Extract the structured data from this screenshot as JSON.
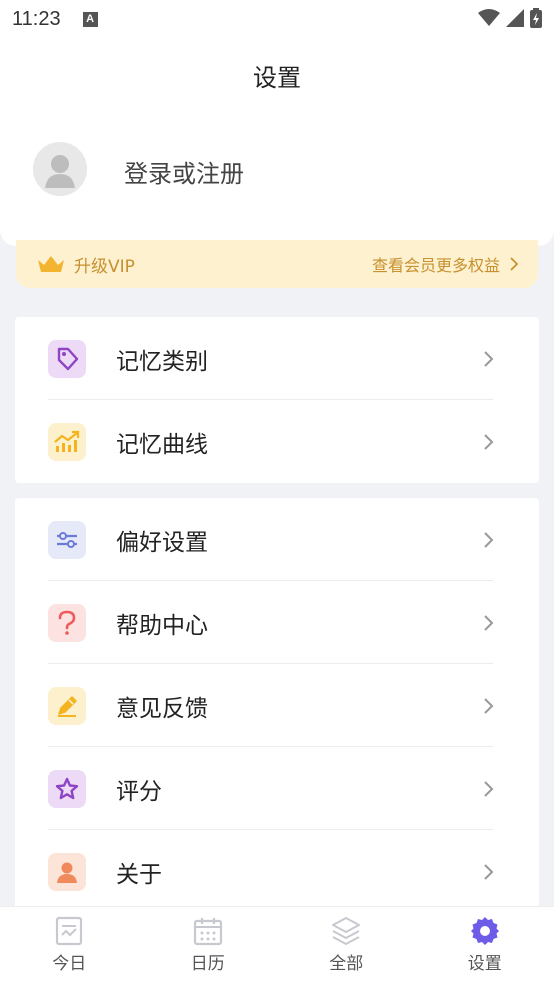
{
  "status_bar": {
    "time": "11:23",
    "notification_icon": "A"
  },
  "header": {
    "title": "设置"
  },
  "account": {
    "login_label": "登录或注册"
  },
  "vip": {
    "label": "升级VIP",
    "benefits_link": "查看会员更多权益"
  },
  "groups": [
    {
      "items": [
        {
          "label": "记忆类别",
          "icon": "tag-icon",
          "color": "#8e44c4"
        },
        {
          "label": "记忆曲线",
          "icon": "chart-trend-icon",
          "color": "#f5b41f"
        }
      ]
    },
    {
      "items": [
        {
          "label": "偏好设置",
          "icon": "sliders-icon",
          "color": "#6c7bd8"
        },
        {
          "label": "帮助中心",
          "icon": "question-icon",
          "color": "#ef5b5b"
        },
        {
          "label": "意见反馈",
          "icon": "pencil-icon",
          "color": "#f5b41f"
        },
        {
          "label": "评分",
          "icon": "star-icon",
          "color": "#8e44c4"
        },
        {
          "label": "关于",
          "icon": "person-icon",
          "color": "#f08a5d"
        }
      ]
    }
  ],
  "tab_bar": {
    "tabs": [
      {
        "label": "今日",
        "icon": "today-icon",
        "active": false
      },
      {
        "label": "日历",
        "icon": "calendar-icon",
        "active": false
      },
      {
        "label": "全部",
        "icon": "layers-icon",
        "active": false
      },
      {
        "label": "设置",
        "icon": "settings-gear-icon",
        "active": true
      }
    ],
    "active_color": "#6c5ce7",
    "inactive_color": "#c8c8d0"
  }
}
